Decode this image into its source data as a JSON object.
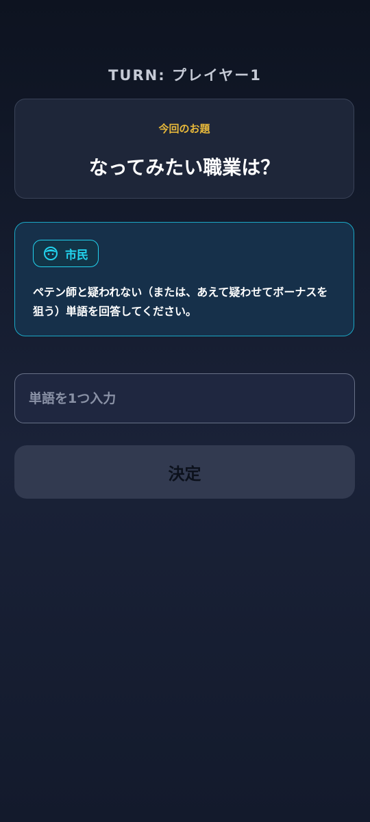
{
  "turn": {
    "label": "TURN: プレイヤー1"
  },
  "topic": {
    "caption": "今回のお題",
    "question": "なってみたい職業は？"
  },
  "role": {
    "icon": "person-face-icon",
    "name": "市民",
    "description": "ペテン師と疑われない（または、あえて疑わせてボーナスを狙う）単語を回答してください。"
  },
  "answer": {
    "placeholder": "単語を1つ入力",
    "value": ""
  },
  "submit": {
    "label": "決定"
  },
  "colors": {
    "accent_cyan": "#22d3ee",
    "caption_gold": "#e8b93a",
    "button_bg": "#323a50"
  }
}
